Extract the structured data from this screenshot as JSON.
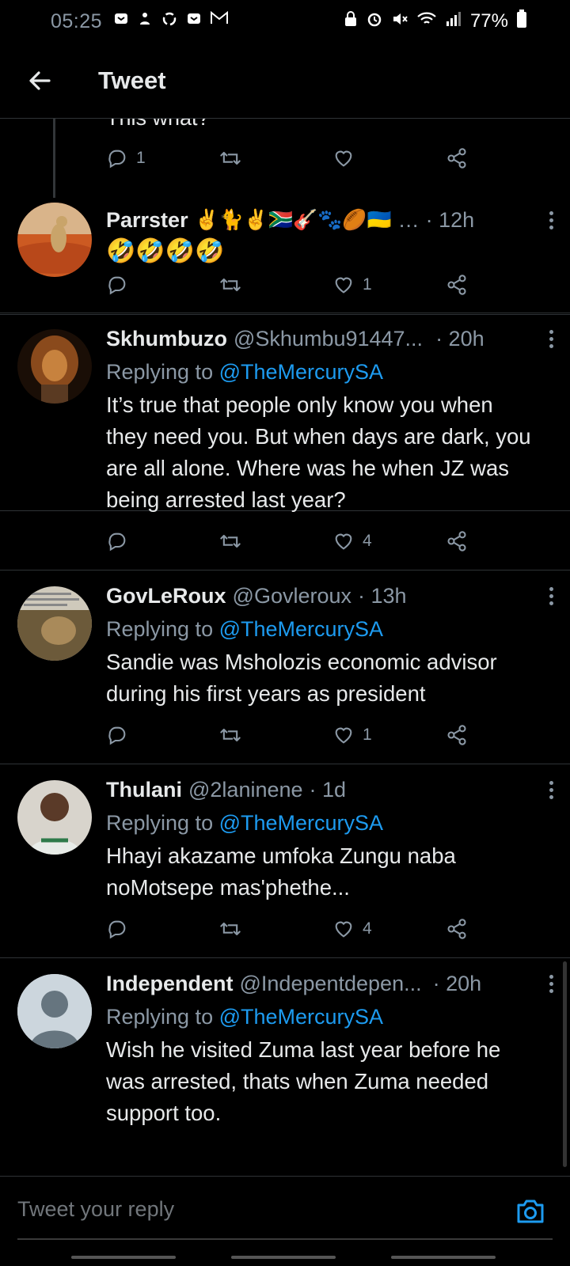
{
  "status_bar": {
    "time": "05:25",
    "battery": "77%",
    "left_icons": [
      "notification-icon",
      "notification-icon",
      "sync-icon",
      "notification-icon",
      "mail-icon"
    ],
    "right_icons": [
      "lock-icon",
      "alarm-icon",
      "mute-icon",
      "wifi-icon",
      "signal-icon",
      "battery-icon"
    ]
  },
  "header": {
    "title": "Tweet"
  },
  "partial_tweet": {
    "cut_text": "This what?",
    "reply_count": "1"
  },
  "tweets": [
    {
      "name": "Parrster",
      "name_emojis": "✌️🐈✌️🇿🇦🎸🐾🏉🇺🇦",
      "ellipsis": "…",
      "time": "· 12h",
      "body": "🤣🤣🤣🤣",
      "likes": "1"
    },
    {
      "name": "Skhumbuzo",
      "handle": "@Skhumbu91447...",
      "time": "· 20h",
      "replying_prefix": "Replying to ",
      "replying_to": "@TheMercurySA",
      "body": "It’s true that people only know you when they need you. But when days are dark, you are all alone. Where was he when JZ was being arrested last year?",
      "likes": "4"
    },
    {
      "name": "GovLeRoux",
      "handle": "@Govleroux",
      "time": "· 13h",
      "replying_prefix": "Replying to ",
      "replying_to": "@TheMercurySA",
      "body": "Sandie was Msholozis economic advisor during his first years as president",
      "likes": "1"
    },
    {
      "name": "Thulani",
      "handle": "@2laninene",
      "time": "· 1d",
      "replying_prefix": "Replying to ",
      "replying_to": "@TheMercurySA",
      "body": "Hhayi akazame umfoka Zungu naba noMotsepe mas'phethe...",
      "likes": "4"
    },
    {
      "name": "Independent",
      "handle": "@Indepentdepen...",
      "time": "· 20h",
      "replying_prefix": "Replying to ",
      "replying_to": "@TheMercurySA",
      "body": "Wish he visited Zuma last year before he was arrested, thats when Zuma needed support too."
    }
  ],
  "reply_bar": {
    "placeholder": "Tweet your reply"
  },
  "colors": {
    "background": "#000000",
    "link": "#1d9bf0",
    "muted": "#8b98a5",
    "text": "#e7e9ea"
  }
}
